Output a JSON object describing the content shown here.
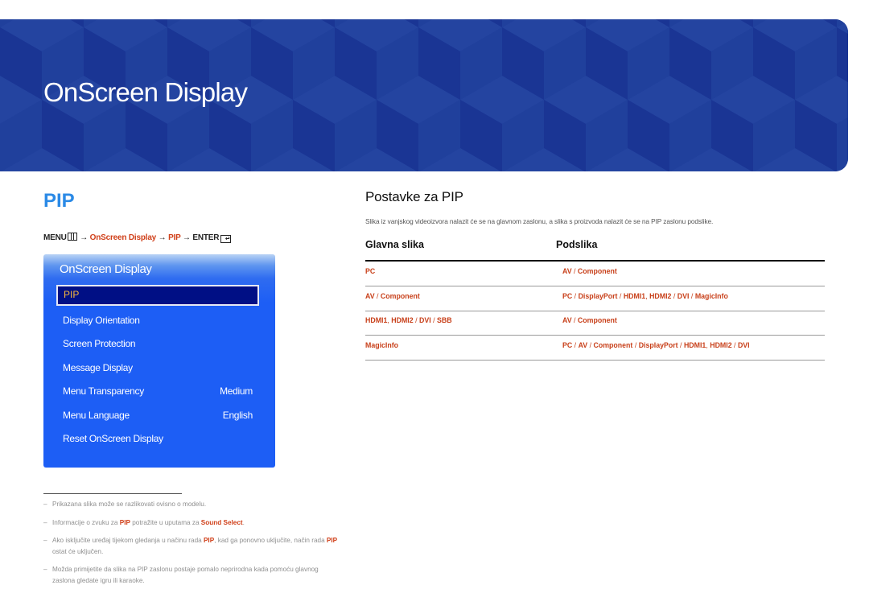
{
  "banner": {
    "title": "OnScreen Display",
    "background_color": "#1d3a9a"
  },
  "section": {
    "title": "PIP",
    "title_color": "#2b8ae6",
    "menu_path": {
      "menu_label": "MENU",
      "menu_icon": "menu-grid-icon",
      "arrow": "→",
      "step1": "OnScreen Display",
      "step2": "PIP",
      "enter_label": "ENTER",
      "enter_icon": "enter-icon"
    }
  },
  "osd_panel": {
    "title": "OnScreen Display",
    "selected_item": "PIP",
    "items": [
      {
        "label": "Display Orientation",
        "value": ""
      },
      {
        "label": "Screen Protection",
        "value": ""
      },
      {
        "label": "Message Display",
        "value": ""
      },
      {
        "label": "Menu Transparency",
        "value": "Medium"
      },
      {
        "label": "Menu Language",
        "value": "English"
      },
      {
        "label": "Reset OnScreen Display",
        "value": ""
      }
    ],
    "highlight_text_color": "#f6b73c",
    "panel_color": "#1d5ef5"
  },
  "notes": [
    {
      "text": "Prikazana slika može se razlikovati ovisno o modelu."
    },
    {
      "parts": [
        "Informacije o zvuku za ",
        "PIP",
        " potražite u uputama za ",
        "Sound Select",
        "."
      ]
    },
    {
      "parts": [
        "Ako isključite uređaj tijekom gledanja u načinu rada ",
        "PIP",
        ", kad ga ponovno uključite, način rada ",
        "PIP",
        " ostat će uključen."
      ]
    },
    {
      "text": "Možda primijetite da slika na PIP zaslonu postaje pomalo neprirodna kada pomoću glavnog zaslona gledate igru ili karaoke."
    }
  ],
  "settings": {
    "title": "Postavke za PIP",
    "description": "Slika iz vanjskog videoizvora nalazit će se na glavnom zaslonu, a slika s proizvoda nalazit će se na PIP zaslonu podslike.",
    "table": {
      "headers": [
        "Glavna slika",
        "Podslika"
      ],
      "rows": [
        {
          "main": "PC",
          "sub": "AV / Component"
        },
        {
          "main": "AV / Component",
          "sub": "PC / DisplayPort / HDMI1, HDMI2 / DVI / MagicInfo"
        },
        {
          "main": "HDMI1, HDMI2 / DVI / SBB",
          "sub": "AV / Component"
        },
        {
          "main": "MagicInfo",
          "sub": "PC / AV / Component / DisplayPort / HDMI1, HDMI2 / DVI"
        }
      ],
      "cell_color": "#c8401a"
    }
  }
}
